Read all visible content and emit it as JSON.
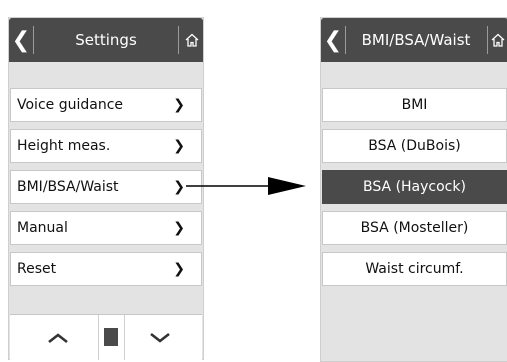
{
  "left_screen": {
    "title": "Settings",
    "back_glyph": "❮",
    "items": [
      {
        "label": "Voice guidance",
        "chevron": "❯"
      },
      {
        "label": "Height meas.",
        "chevron": "❯"
      },
      {
        "label": "BMI/BSA/Waist",
        "chevron": "❯"
      },
      {
        "label": "Manual",
        "chevron": "❯"
      },
      {
        "label": "Reset",
        "chevron": "❯"
      }
    ]
  },
  "right_screen": {
    "title": "BMI/BSA/Waist",
    "back_glyph": "❮",
    "options": [
      {
        "label": "BMI"
      },
      {
        "label": "BSA (DuBois)"
      },
      {
        "label": "BSA (Haycock)"
      },
      {
        "label": "BSA (Mosteller)"
      },
      {
        "label": "Waist circumf."
      }
    ],
    "selected_option": "BSA (Haycock)"
  },
  "colors": {
    "bar": "#4a4a4a",
    "screen_bg": "#e3e3e3",
    "item_bg": "#ffffff"
  }
}
